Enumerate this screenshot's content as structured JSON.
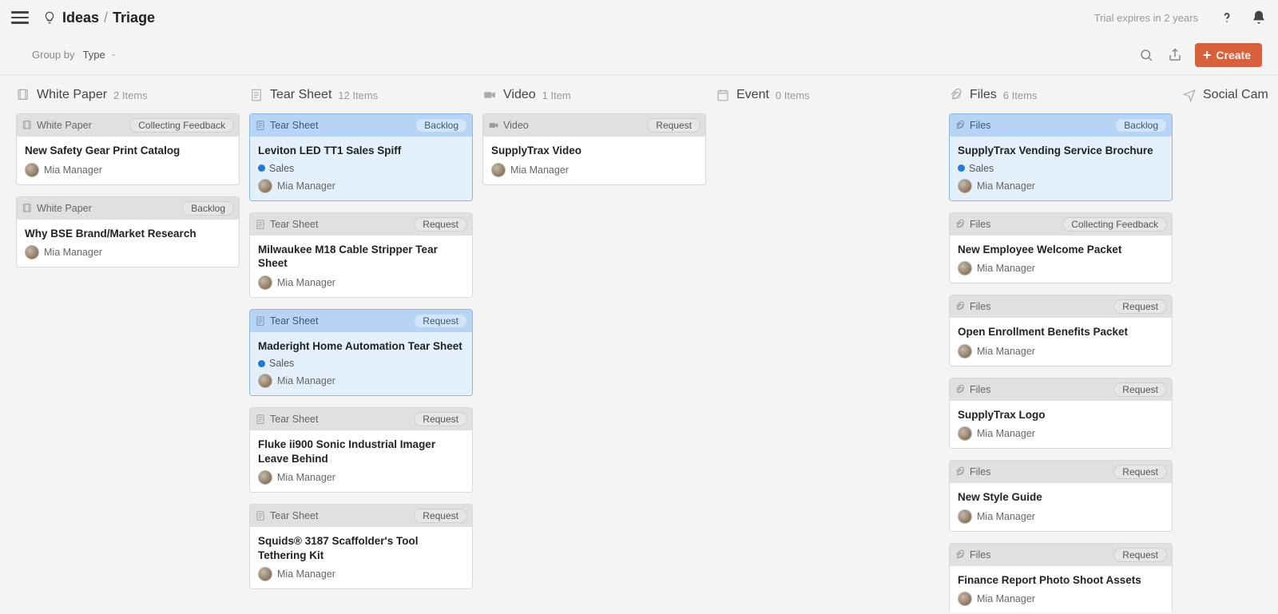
{
  "top": {
    "ideas": "Ideas",
    "triage": "Triage",
    "trial": "Trial expires in 2 years"
  },
  "toolbar": {
    "group_label": "Group by",
    "group_value": "Type",
    "create": "Create"
  },
  "columns": [
    {
      "type": "whitepaper",
      "title": "White Paper",
      "count": "2 Items",
      "cards": [
        {
          "type_label": "White Paper",
          "status": "Collecting Feedback",
          "title": "New Safety Gear Print Catalog",
          "owner": "Mia Manager",
          "tag": null,
          "selected": false
        },
        {
          "type_label": "White Paper",
          "status": "Backlog",
          "title": "Why BSE Brand/Market Research",
          "owner": "Mia Manager",
          "tag": null,
          "selected": false
        }
      ]
    },
    {
      "type": "tearsheet",
      "title": "Tear Sheet",
      "count": "12 Items",
      "cards": [
        {
          "type_label": "Tear Sheet",
          "status": "Backlog",
          "title": "Leviton LED TT1 Sales Spiff",
          "owner": "Mia Manager",
          "tag": "Sales",
          "selected": true
        },
        {
          "type_label": "Tear Sheet",
          "status": "Request",
          "title": "Milwaukee M18 Cable Stripper Tear Sheet",
          "owner": "Mia Manager",
          "tag": null,
          "selected": false
        },
        {
          "type_label": "Tear Sheet",
          "status": "Request",
          "title": "Maderight Home Automation Tear Sheet",
          "owner": "Mia Manager",
          "tag": "Sales",
          "selected": true
        },
        {
          "type_label": "Tear Sheet",
          "status": "Request",
          "title": "Fluke ii900 Sonic Industrial Imager Leave Behind",
          "owner": "Mia Manager",
          "tag": null,
          "selected": false
        },
        {
          "type_label": "Tear Sheet",
          "status": "Request",
          "title": "Squids® 3187 Scaffolder's Tool Tethering Kit",
          "owner": "Mia Manager",
          "tag": null,
          "selected": false
        }
      ]
    },
    {
      "type": "video",
      "title": "Video",
      "count": "1 Item",
      "cards": [
        {
          "type_label": "Video",
          "status": "Request",
          "title": "SupplyTrax Video",
          "owner": "Mia Manager",
          "tag": null,
          "selected": false
        }
      ]
    },
    {
      "type": "event",
      "title": "Event",
      "count": "0 Items",
      "cards": []
    },
    {
      "type": "files",
      "title": "Files",
      "count": "6 Items",
      "cards": [
        {
          "type_label": "Files",
          "status": "Backlog",
          "title": "SupplyTrax Vending Service Brochure",
          "owner": "Mia Manager",
          "tag": "Sales",
          "selected": true
        },
        {
          "type_label": "Files",
          "status": "Collecting Feedback",
          "title": "New Employee Welcome Packet",
          "owner": "Mia Manager",
          "tag": null,
          "selected": false
        },
        {
          "type_label": "Files",
          "status": "Request",
          "title": "Open Enrollment Benefits Packet",
          "owner": "Mia Manager",
          "tag": null,
          "selected": false
        },
        {
          "type_label": "Files",
          "status": "Request",
          "title": "SupplyTrax Logo",
          "owner": "Mia Manager",
          "tag": null,
          "selected": false
        },
        {
          "type_label": "Files",
          "status": "Request",
          "title": "New Style Guide",
          "owner": "Mia Manager",
          "tag": null,
          "selected": false
        },
        {
          "type_label": "Files",
          "status": "Request",
          "title": "Finance Report Photo Shoot Assets",
          "owner": "Mia Manager",
          "tag": null,
          "selected": false
        }
      ]
    },
    {
      "type": "social",
      "title": "Social Cam",
      "count": "",
      "cards": []
    }
  ]
}
